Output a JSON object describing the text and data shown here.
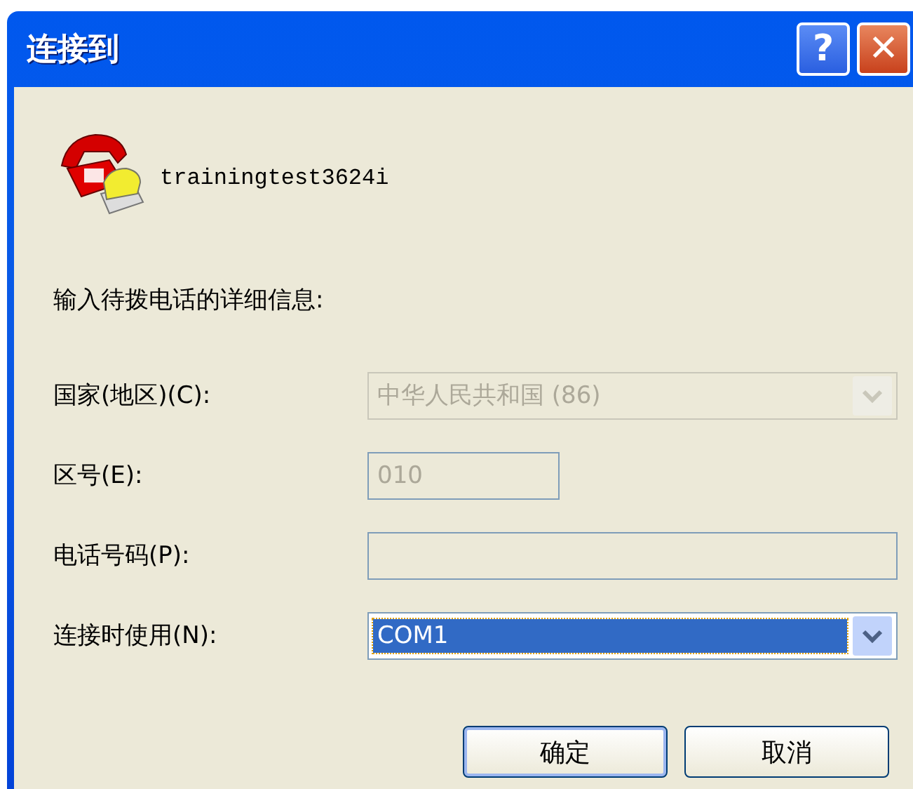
{
  "window": {
    "title": "连接到"
  },
  "title_buttons": [
    {
      "kind": "help",
      "label": "?"
    },
    {
      "kind": "close",
      "label": "✕"
    }
  ],
  "connection_name": "trainingtest3624i",
  "instruction": "输入待拨电话的详细信息:",
  "fields": [
    {
      "kind": "dropdown",
      "label": "国家(地区)(C):",
      "value": "中华人民共和国 (86)",
      "disabled": true,
      "selected": false,
      "wide": true
    },
    {
      "kind": "text",
      "label": "区号(E):",
      "value": "010",
      "disabled": true,
      "selected": false,
      "wide": false
    },
    {
      "kind": "text",
      "label": "电话号码(P):",
      "disabled": true,
      "selected": false,
      "wide": true
    },
    {
      "kind": "dropdown",
      "label": "连接时使用(N):",
      "value": "COM1",
      "disabled": false,
      "selected": true,
      "wide": true
    }
  ],
  "buttons": [
    {
      "label": "确定",
      "default": true
    },
    {
      "label": "取消",
      "default": false
    }
  ]
}
